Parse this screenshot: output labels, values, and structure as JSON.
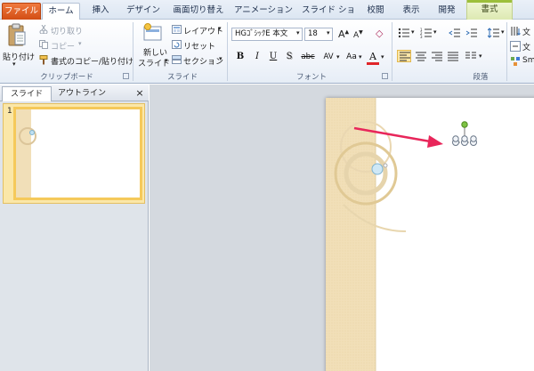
{
  "tabs": {
    "file": "ファイル",
    "home": "ホーム",
    "insert": "挿入",
    "design": "デザイン",
    "transitions": "画面切り替え",
    "animations": "アニメーション",
    "slideshow": "スライド ショー",
    "review": "校閲",
    "view": "表示",
    "developer": "開発",
    "format": "書式"
  },
  "clipboard": {
    "paste": "貼り付け",
    "cut": "切り取り",
    "copy": "コピー",
    "format_painter": "書式のコピー/貼り付け",
    "label": "クリップボード"
  },
  "slides_group": {
    "new_slide_line1": "新しい",
    "new_slide_line2": "スライド",
    "layout": "レイアウト",
    "reset": "リセット",
    "section": "セクション",
    "label": "スライド"
  },
  "font_group": {
    "font_name": "HGｺﾞｼｯｸE 本文",
    "font_size": "18",
    "label": "フォント",
    "bold": "B",
    "italic": "I",
    "underline": "U",
    "shadow": "S",
    "strike": "abc",
    "spacing": "AV",
    "case": "Aa",
    "color_letter": "A"
  },
  "paragraph_group": {
    "label": "段落",
    "text_direction": "文",
    "align_text": "文",
    "smartart": "Sm"
  },
  "leftpane": {
    "tab_slides": "スライド",
    "tab_outline": "アウトライン",
    "close": "×",
    "slide_number": "1"
  },
  "colors": {
    "accent_file": "#d24d14",
    "arrow": "#e8265a",
    "selection_handle_rotate": "#7dc243",
    "thumb_highlight": "#f5c95a",
    "slide_band": "#f1dfb8"
  }
}
